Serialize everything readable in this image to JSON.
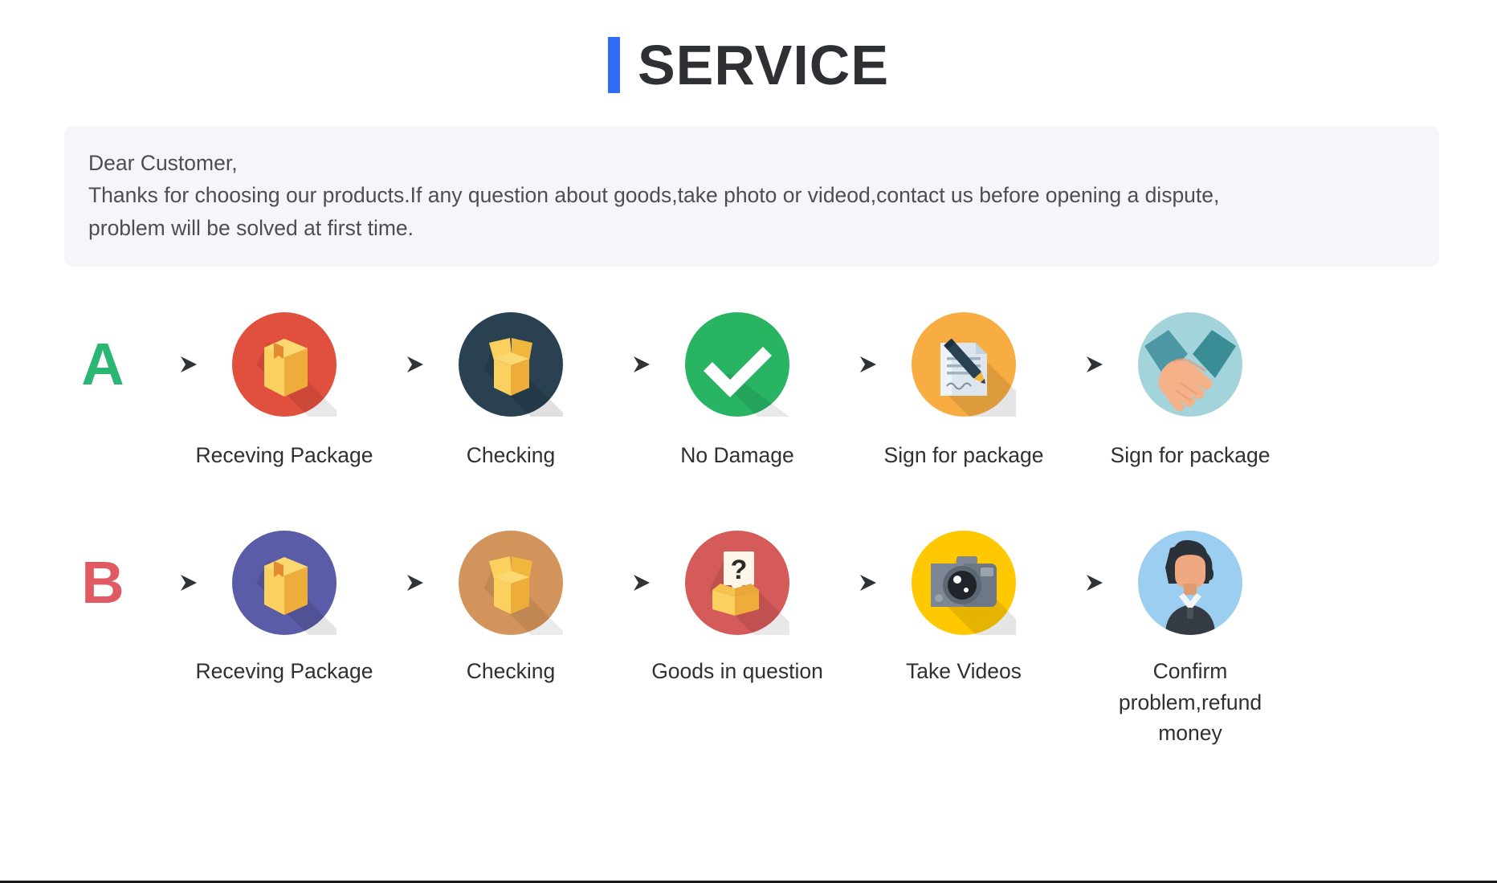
{
  "header": {
    "accent_color": "#2f6bf6",
    "title": "SERVICE",
    "bar_icon": "vertical-bar-icon"
  },
  "notice": {
    "background_color": "#f5f6fa",
    "line1": "Dear Customer,",
    "line2": "Thanks for choosing our products.If any question about goods,take photo or videod,contact us before opening a dispute,",
    "line3": "problem will be solved at first time."
  },
  "flows": [
    {
      "id": "flow-a",
      "letter": "A",
      "letter_color": "#2cb673",
      "arrow_icon": "arrow-right-icon",
      "steps": [
        {
          "label": "Receving Package",
          "icon": "closed-box-icon",
          "circle_color": "#e1503f",
          "shadow_color": "#c8412f"
        },
        {
          "label": "Checking",
          "icon": "open-box-icon",
          "circle_color": "#2a4152",
          "shadow_color": "#1e3140"
        },
        {
          "label": "No Damage",
          "icon": "check-mark-icon",
          "circle_color": "#28b463",
          "shadow_color": "#1e9c52"
        },
        {
          "label": "Sign for package",
          "icon": "document-pen-icon",
          "circle_color": "#f8ad42",
          "shadow_color": "#f39c12"
        },
        {
          "label": "Sign for package",
          "icon": "handshake-icon",
          "circle_color": "#a3d4dc",
          "shadow_color": "#8fc8d2"
        }
      ]
    },
    {
      "id": "flow-b",
      "letter": "B",
      "letter_color": "#e05a63",
      "arrow_icon": "arrow-right-icon",
      "steps": [
        {
          "label": "Receving Package",
          "icon": "closed-box-icon",
          "circle_color": "#5b5ca8",
          "shadow_color": "#4b4c92"
        },
        {
          "label": "Checking",
          "icon": "open-box-icon",
          "circle_color": "#d2945b",
          "shadow_color": "#bf8048"
        },
        {
          "label": "Goods in question",
          "icon": "question-box-icon",
          "circle_color": "#d55a5a",
          "shadow_color": "#c24a4a"
        },
        {
          "label": "Take Videos",
          "icon": "camera-icon",
          "circle_color": "#ffc800",
          "shadow_color": "#f5a600"
        },
        {
          "label": "Confirm problem,refund money",
          "icon": "support-person-icon",
          "circle_color": "#9ccef2",
          "shadow_color": "#86bfe8"
        }
      ]
    }
  ]
}
